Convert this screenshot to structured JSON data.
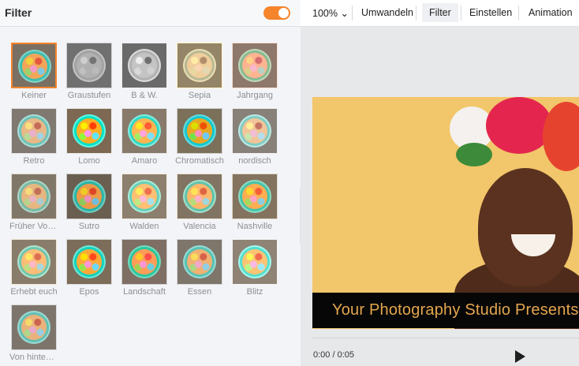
{
  "panel": {
    "title": "Filter",
    "toggle_on": true,
    "accent": "#f5842b"
  },
  "filters": [
    {
      "label": "Keiner",
      "tone": "normal",
      "selected": true
    },
    {
      "label": "Graustufen",
      "tone": "gray"
    },
    {
      "label": "B & W.",
      "tone": "bw"
    },
    {
      "label": "Sepia",
      "tone": "sepia"
    },
    {
      "label": "Jahrgang",
      "tone": "vintage"
    },
    {
      "label": "Retro",
      "tone": "retro"
    },
    {
      "label": "Lomo",
      "tone": "lomo"
    },
    {
      "label": "Amaro",
      "tone": "amaro"
    },
    {
      "label": "Chromatisch",
      "tone": "chrome"
    },
    {
      "label": "nordisch",
      "tone": "nordic"
    },
    {
      "label": "Früher Vogel",
      "tone": "early"
    },
    {
      "label": "Sutro",
      "tone": "sutro"
    },
    {
      "label": "Walden",
      "tone": "walden"
    },
    {
      "label": "Valencia",
      "tone": "valencia"
    },
    {
      "label": "Nashville",
      "tone": "nashville"
    },
    {
      "label": "Erhebt euch",
      "tone": "rise"
    },
    {
      "label": "Epos",
      "tone": "epos"
    },
    {
      "label": "Landschaft",
      "tone": "landscape"
    },
    {
      "label": "Essen",
      "tone": "food"
    },
    {
      "label": "Blitz",
      "tone": "flash"
    },
    {
      "label": "Von hinten ...",
      "tone": "back"
    }
  ],
  "toolbar": {
    "zoom": "100%",
    "items": [
      "Umwandeln",
      "Filter",
      "Einstellen",
      "Animation"
    ],
    "active": "Filter"
  },
  "preview": {
    "caption": "Your Photography Studio Presents",
    "time": "0:00 / 0:05"
  }
}
